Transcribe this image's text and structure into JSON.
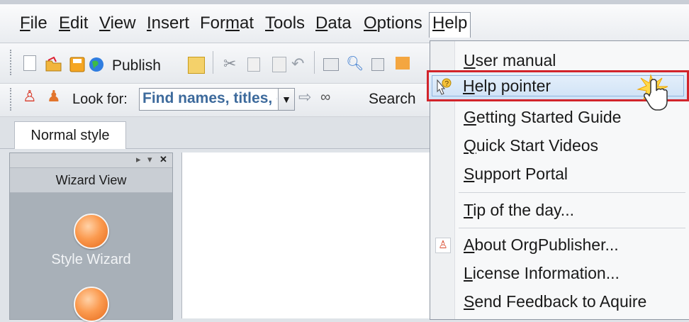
{
  "menubar": {
    "items": [
      {
        "pre": "",
        "u": "F",
        "post": "ile"
      },
      {
        "pre": "",
        "u": "E",
        "post": "dit"
      },
      {
        "pre": "",
        "u": "V",
        "post": "iew"
      },
      {
        "pre": "",
        "u": "I",
        "post": "nsert"
      },
      {
        "pre": "For",
        "u": "m",
        "post": "at"
      },
      {
        "pre": "",
        "u": "T",
        "post": "ools"
      },
      {
        "pre": "",
        "u": "D",
        "post": "ata"
      },
      {
        "pre": "",
        "u": "O",
        "post": "ptions"
      },
      {
        "pre": "",
        "u": "H",
        "post": "elp"
      }
    ]
  },
  "toolbar1": {
    "publish_label": "Publish"
  },
  "toolbar2": {
    "look_for_label": "Look for:",
    "search_placeholder": "Find names, titles, e",
    "search_label": "Search"
  },
  "tabs": {
    "normal_style": "Normal style"
  },
  "wizard": {
    "title": "Wizard View",
    "style_wizard": "Style Wizard"
  },
  "help_menu": {
    "items": [
      {
        "pre": "",
        "u": "U",
        "post": "ser manual"
      },
      {
        "pre": "",
        "u": "H",
        "post": "elp pointer"
      },
      {
        "pre": "",
        "u": "G",
        "post": "etting Started Guide"
      },
      {
        "pre": "",
        "u": "Q",
        "post": "uick Start Videos"
      },
      {
        "pre": "",
        "u": "S",
        "post": "upport Portal"
      },
      {
        "pre": "",
        "u": "T",
        "post": "ip of the day..."
      },
      {
        "pre": "",
        "u": "A",
        "post": "bout OrgPublisher..."
      },
      {
        "pre": "",
        "u": "L",
        "post": "icense Information..."
      },
      {
        "pre": "",
        "u": "S",
        "post": "end Feedback to Aquire"
      }
    ]
  },
  "colors": {
    "highlight_border": "#d2242b",
    "accent_orange": "#fb9a4f"
  }
}
